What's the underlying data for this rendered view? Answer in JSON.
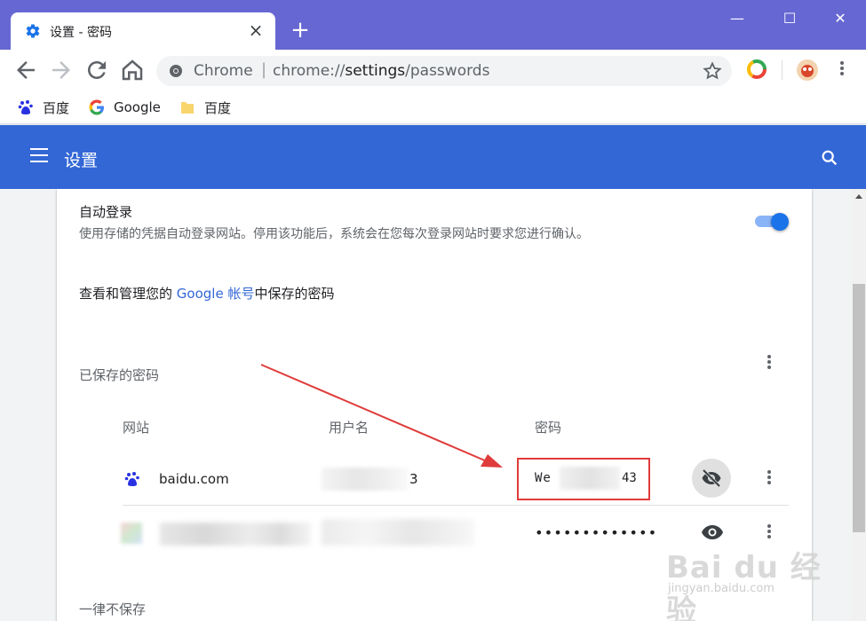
{
  "browser": {
    "tab_title": "设置 - 密码",
    "tab_close": "×",
    "new_tab": "+",
    "window_controls": {
      "minimize": "—",
      "maximize": "☐",
      "close": "✕"
    }
  },
  "omnibox": {
    "scheme_label": "Chrome",
    "separator": "|",
    "url_prefix": "chrome://",
    "url_host": "settings",
    "url_path": "/passwords"
  },
  "bookmarks": [
    {
      "label": "百度",
      "icon": "baidu-paw-icon"
    },
    {
      "label": "Google",
      "icon": "google-g-icon"
    },
    {
      "label": "百度",
      "icon": "folder-icon"
    }
  ],
  "settings": {
    "title": "设置"
  },
  "autologin": {
    "title": "自动登录",
    "description": "使用存储的凭据自动登录网站。停用该功能后，系统会在您每次登录网站时要求您进行确认。",
    "enabled": true
  },
  "manage": {
    "prefix": "查看和管理您的",
    "link": "Google 帐号",
    "suffix": "中保存的密码"
  },
  "saved_passwords": {
    "title": "已保存的密码",
    "columns": {
      "site": "网站",
      "username": "用户名",
      "password": "密码"
    },
    "rows": [
      {
        "site": "baidu.com",
        "username_visible": "3",
        "password_start": "We",
        "password_end": "43",
        "revealed": true
      },
      {
        "site": "",
        "username_visible": "",
        "password_masked": "•••••••••••••",
        "revealed": false
      }
    ]
  },
  "never_saved": {
    "title": "一律不保存"
  },
  "watermark": {
    "main": "Bai du 经验",
    "sub": "jingyan.baidu.com"
  },
  "colors": {
    "tabstrip": "#6667d3",
    "header": "#3367d6",
    "toggle": "#1a73e8",
    "annotation": "#e03b3b"
  }
}
